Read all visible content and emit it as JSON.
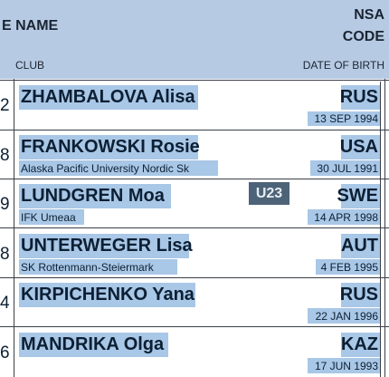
{
  "header": {
    "name_label": "E NAME",
    "nsa_label": "NSA",
    "code_label": "CODE",
    "club_label": "CLUB",
    "dob_label": "DATE OF BIRTH"
  },
  "rows": [
    {
      "rank": "2",
      "name": "ZHAMBALOVA Alisa",
      "nsa": "RUS",
      "club": "",
      "dob": "13 SEP 1994"
    },
    {
      "rank": "8",
      "name": "FRANKOWSKI Rosie",
      "nsa": "USA",
      "club": "Alaska Pacific University Nordic Sk",
      "dob": "30 JUL 1991"
    },
    {
      "rank": "9",
      "name": "LUNDGREN Moa",
      "nsa": "SWE",
      "club": "IFK Umeaa",
      "dob": "14 APR 1998",
      "badge": "U23"
    },
    {
      "rank": "8",
      "name": "UNTERWEGER Lisa",
      "nsa": "AUT",
      "club": "SK Rottenmann-Steiermark",
      "dob": "4 FEB 1995"
    },
    {
      "rank": "4",
      "name": "KIRPICHENKO Yana",
      "nsa": "RUS",
      "club": "",
      "dob": "22 JAN 1996"
    },
    {
      "rank": "6",
      "name": "MANDRIKA Olga",
      "nsa": "KAZ",
      "club": "",
      "dob": "17 JUN 1993"
    }
  ]
}
